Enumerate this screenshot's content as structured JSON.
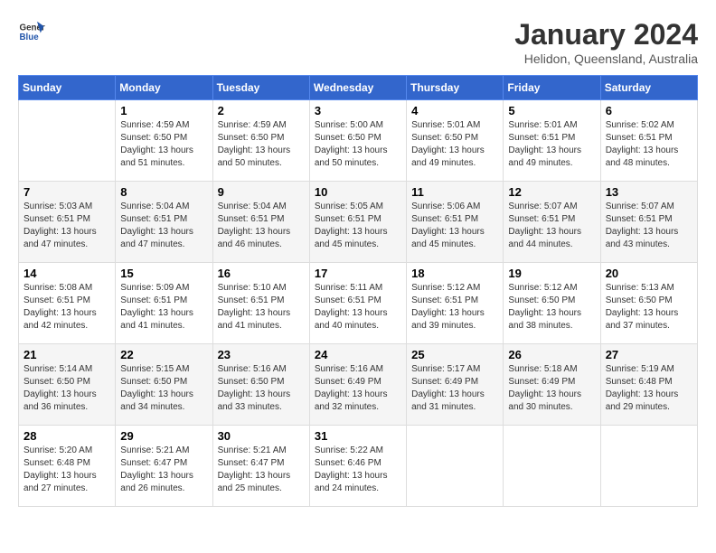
{
  "header": {
    "logo_general": "General",
    "logo_blue": "Blue",
    "title": "January 2024",
    "subtitle": "Helidon, Queensland, Australia"
  },
  "days_of_week": [
    "Sunday",
    "Monday",
    "Tuesday",
    "Wednesday",
    "Thursday",
    "Friday",
    "Saturday"
  ],
  "weeks": [
    [
      {
        "day": "",
        "info": ""
      },
      {
        "day": "1",
        "info": "Sunrise: 4:59 AM\nSunset: 6:50 PM\nDaylight: 13 hours\nand 51 minutes."
      },
      {
        "day": "2",
        "info": "Sunrise: 4:59 AM\nSunset: 6:50 PM\nDaylight: 13 hours\nand 50 minutes."
      },
      {
        "day": "3",
        "info": "Sunrise: 5:00 AM\nSunset: 6:50 PM\nDaylight: 13 hours\nand 50 minutes."
      },
      {
        "day": "4",
        "info": "Sunrise: 5:01 AM\nSunset: 6:50 PM\nDaylight: 13 hours\nand 49 minutes."
      },
      {
        "day": "5",
        "info": "Sunrise: 5:01 AM\nSunset: 6:51 PM\nDaylight: 13 hours\nand 49 minutes."
      },
      {
        "day": "6",
        "info": "Sunrise: 5:02 AM\nSunset: 6:51 PM\nDaylight: 13 hours\nand 48 minutes."
      }
    ],
    [
      {
        "day": "7",
        "info": "Sunrise: 5:03 AM\nSunset: 6:51 PM\nDaylight: 13 hours\nand 47 minutes."
      },
      {
        "day": "8",
        "info": "Sunrise: 5:04 AM\nSunset: 6:51 PM\nDaylight: 13 hours\nand 47 minutes."
      },
      {
        "day": "9",
        "info": "Sunrise: 5:04 AM\nSunset: 6:51 PM\nDaylight: 13 hours\nand 46 minutes."
      },
      {
        "day": "10",
        "info": "Sunrise: 5:05 AM\nSunset: 6:51 PM\nDaylight: 13 hours\nand 45 minutes."
      },
      {
        "day": "11",
        "info": "Sunrise: 5:06 AM\nSunset: 6:51 PM\nDaylight: 13 hours\nand 45 minutes."
      },
      {
        "day": "12",
        "info": "Sunrise: 5:07 AM\nSunset: 6:51 PM\nDaylight: 13 hours\nand 44 minutes."
      },
      {
        "day": "13",
        "info": "Sunrise: 5:07 AM\nSunset: 6:51 PM\nDaylight: 13 hours\nand 43 minutes."
      }
    ],
    [
      {
        "day": "14",
        "info": "Sunrise: 5:08 AM\nSunset: 6:51 PM\nDaylight: 13 hours\nand 42 minutes."
      },
      {
        "day": "15",
        "info": "Sunrise: 5:09 AM\nSunset: 6:51 PM\nDaylight: 13 hours\nand 41 minutes."
      },
      {
        "day": "16",
        "info": "Sunrise: 5:10 AM\nSunset: 6:51 PM\nDaylight: 13 hours\nand 41 minutes."
      },
      {
        "day": "17",
        "info": "Sunrise: 5:11 AM\nSunset: 6:51 PM\nDaylight: 13 hours\nand 40 minutes."
      },
      {
        "day": "18",
        "info": "Sunrise: 5:12 AM\nSunset: 6:51 PM\nDaylight: 13 hours\nand 39 minutes."
      },
      {
        "day": "19",
        "info": "Sunrise: 5:12 AM\nSunset: 6:50 PM\nDaylight: 13 hours\nand 38 minutes."
      },
      {
        "day": "20",
        "info": "Sunrise: 5:13 AM\nSunset: 6:50 PM\nDaylight: 13 hours\nand 37 minutes."
      }
    ],
    [
      {
        "day": "21",
        "info": "Sunrise: 5:14 AM\nSunset: 6:50 PM\nDaylight: 13 hours\nand 36 minutes."
      },
      {
        "day": "22",
        "info": "Sunrise: 5:15 AM\nSunset: 6:50 PM\nDaylight: 13 hours\nand 34 minutes."
      },
      {
        "day": "23",
        "info": "Sunrise: 5:16 AM\nSunset: 6:50 PM\nDaylight: 13 hours\nand 33 minutes."
      },
      {
        "day": "24",
        "info": "Sunrise: 5:16 AM\nSunset: 6:49 PM\nDaylight: 13 hours\nand 32 minutes."
      },
      {
        "day": "25",
        "info": "Sunrise: 5:17 AM\nSunset: 6:49 PM\nDaylight: 13 hours\nand 31 minutes."
      },
      {
        "day": "26",
        "info": "Sunrise: 5:18 AM\nSunset: 6:49 PM\nDaylight: 13 hours\nand 30 minutes."
      },
      {
        "day": "27",
        "info": "Sunrise: 5:19 AM\nSunset: 6:48 PM\nDaylight: 13 hours\nand 29 minutes."
      }
    ],
    [
      {
        "day": "28",
        "info": "Sunrise: 5:20 AM\nSunset: 6:48 PM\nDaylight: 13 hours\nand 27 minutes."
      },
      {
        "day": "29",
        "info": "Sunrise: 5:21 AM\nSunset: 6:47 PM\nDaylight: 13 hours\nand 26 minutes."
      },
      {
        "day": "30",
        "info": "Sunrise: 5:21 AM\nSunset: 6:47 PM\nDaylight: 13 hours\nand 25 minutes."
      },
      {
        "day": "31",
        "info": "Sunrise: 5:22 AM\nSunset: 6:46 PM\nDaylight: 13 hours\nand 24 minutes."
      },
      {
        "day": "",
        "info": ""
      },
      {
        "day": "",
        "info": ""
      },
      {
        "day": "",
        "info": ""
      }
    ]
  ]
}
